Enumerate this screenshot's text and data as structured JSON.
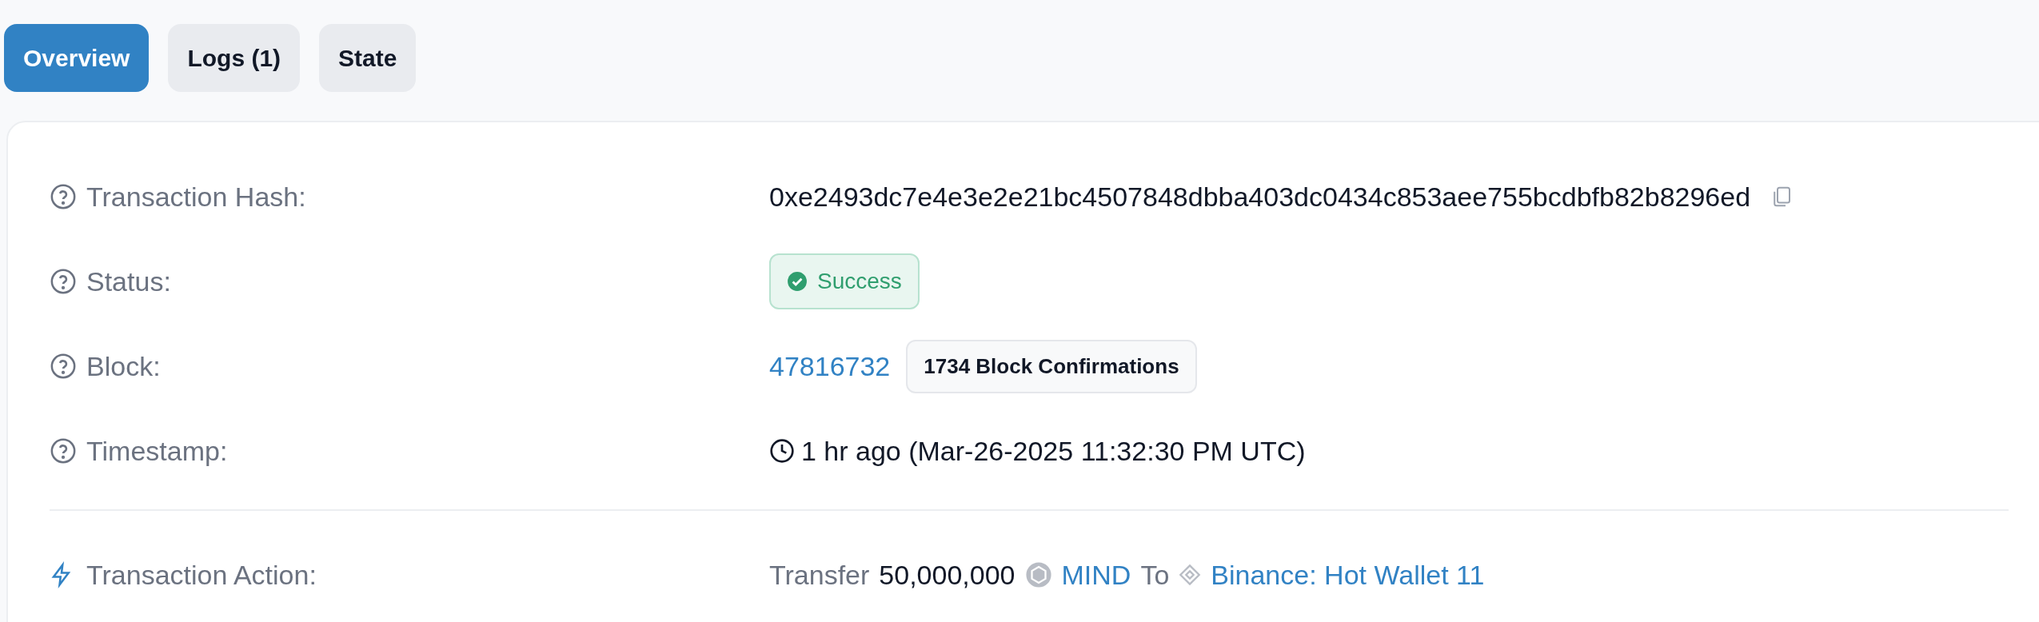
{
  "tabs": [
    {
      "label": "Overview",
      "selected": true
    },
    {
      "label": "Logs (1)",
      "selected": false
    },
    {
      "label": "State",
      "selected": false
    }
  ],
  "rows": [
    {
      "kind": "hash",
      "label": "Transaction Hash:",
      "value": "0xe2493dc7e4e3e2e21bc4507848dbba403dc0434c853aee755bcdbfb82b8296ed"
    },
    {
      "kind": "status",
      "label": "Status:",
      "value": "Success"
    },
    {
      "kind": "block",
      "label": "Block:",
      "value": "47816732",
      "badge": "1734 Block Confirmations"
    },
    {
      "kind": "time",
      "label": "Timestamp:",
      "value": "1 hr ago (Mar-26-2025 11:32:30 PM UTC)"
    }
  ],
  "action": {
    "label": "Transaction Action:",
    "verb": "Transfer",
    "amount": "50,000,000",
    "token": "MIND",
    "to": "To",
    "recipient": "Binance: Hot Wallet 11"
  }
}
